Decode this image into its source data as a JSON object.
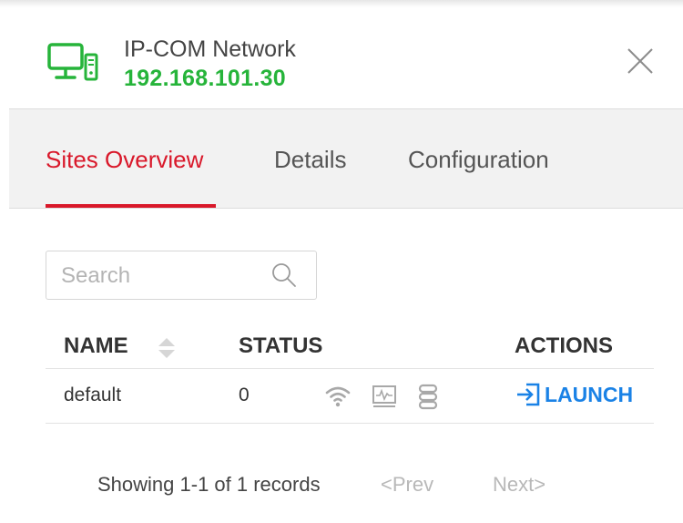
{
  "device": {
    "name": "IP-COM Network",
    "ip": "192.168.101.30",
    "icon": "computer-icon",
    "ip_color": "#26b43a"
  },
  "tabs": [
    {
      "label": "Sites Overview",
      "active": true
    },
    {
      "label": "Details",
      "active": false
    },
    {
      "label": "Configuration",
      "active": false
    }
  ],
  "accent_color": "#d9182a",
  "search": {
    "placeholder": "Search",
    "value": ""
  },
  "table": {
    "headers": {
      "name": "NAME",
      "status": "STATUS",
      "actions": "ACTIONS"
    },
    "rows": [
      {
        "name": "default",
        "status": "0",
        "status_icons": [
          "wifi-icon",
          "monitor-icon",
          "server-icon"
        ],
        "action_label": "LAUNCH",
        "action_icon": "launch-icon"
      }
    ]
  },
  "pagination": {
    "summary": "Showing 1-1 of 1 records",
    "prev": "<Prev",
    "next": "Next>"
  }
}
